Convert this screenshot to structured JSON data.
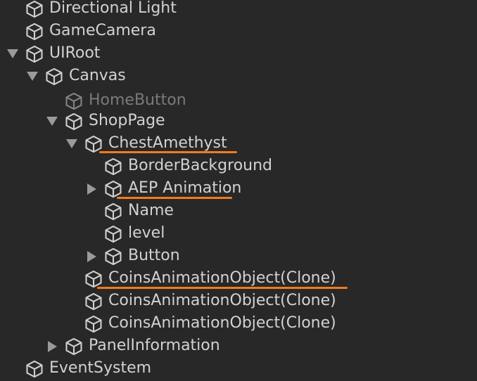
{
  "hierarchy": {
    "items": [
      {
        "label": "Directional Light"
      },
      {
        "label": "GameCamera"
      },
      {
        "label": "UIRoot"
      },
      {
        "label": "Canvas"
      },
      {
        "label": "HomeButton"
      },
      {
        "label": "ShopPage"
      },
      {
        "label": "ChestAmethyst"
      },
      {
        "label": "BorderBackground"
      },
      {
        "label": "AEP Animation"
      },
      {
        "label": "Name"
      },
      {
        "label": "level"
      },
      {
        "label": "Button"
      },
      {
        "label": "CoinsAnimationObject(Clone)"
      },
      {
        "label": "CoinsAnimationObject(Clone)"
      },
      {
        "label": "CoinsAnimationObject(Clone)"
      },
      {
        "label": "PanelInformation"
      },
      {
        "label": "EventSystem"
      }
    ]
  },
  "icons": {
    "item_icon": "gameobject-cube-icon",
    "expanded_icon": "triangle-down-icon",
    "collapsed_icon": "triangle-right-icon"
  },
  "colors": {
    "background": "#282828",
    "text": "#d2d2d2",
    "text_inactive": "#7a7a7a",
    "annotation": "#f07c1e"
  }
}
